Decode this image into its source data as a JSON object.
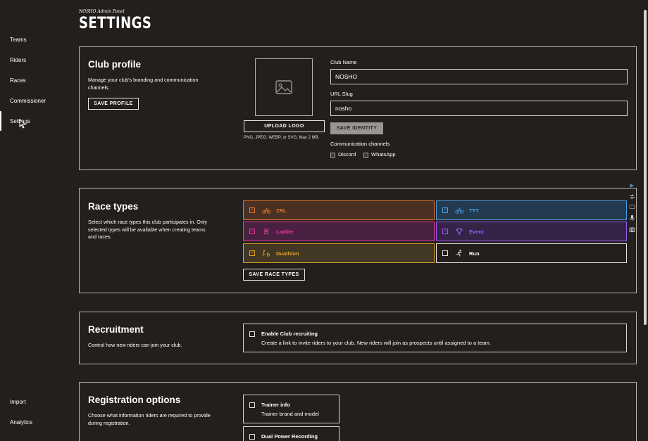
{
  "sidebar": {
    "items": [
      {
        "label": "Teams"
      },
      {
        "label": "Riders"
      },
      {
        "label": "Races"
      },
      {
        "label": "Commissioner"
      },
      {
        "label": "Settings",
        "active": true
      }
    ],
    "bottom_items": [
      {
        "label": "Import"
      },
      {
        "label": "Analytics"
      }
    ]
  },
  "header": {
    "subtitle": "NOSHO Admin Panel",
    "title": "SETTINGS"
  },
  "club_profile": {
    "title": "Club profile",
    "description": "Manage your club's branding and communication channels.",
    "save_label": "SAVE PROFILE",
    "upload_logo_label": "UPLOAD LOGO",
    "logo_hint": "PNG, JPEG, WEBP, or SVG. Max 2 MB.",
    "club_name_label": "Club Name",
    "club_name_value": "NOSHO",
    "url_slug_label": "URL Slug",
    "url_slug_value": "nosho",
    "save_identity_label": "SAVE IDENTITY",
    "channels_label": "Communication channels",
    "channels": [
      {
        "label": "Discord",
        "checked": false
      },
      {
        "label": "WhatsApp",
        "checked": false
      }
    ]
  },
  "race_types": {
    "title": "Race types",
    "description": "Select which race types this club participates in. Only selected types will be available when creating teams and races.",
    "save_label": "SAVE RACE TYPES",
    "types": [
      {
        "label": "ZRL",
        "checked": true,
        "color": "#e8762e",
        "bg": "#4a3124",
        "icon": "cyclist-icon"
      },
      {
        "label": "TTT",
        "checked": true,
        "color": "#4aa0e6",
        "bg": "#243a4e",
        "icon": "bike-icon"
      },
      {
        "label": "Ladder",
        "checked": true,
        "color": "#e63aa6",
        "bg": "#4a2040",
        "icon": "ladder-icon"
      },
      {
        "label": "Event",
        "checked": true,
        "color": "#9a5cf0",
        "bg": "#352448",
        "icon": "trophy-icon"
      },
      {
        "label": "Duathlon",
        "checked": true,
        "color": "#e0a424",
        "bg": "#423624",
        "icon": "duathlon-icon"
      },
      {
        "label": "Run",
        "checked": false,
        "color": "#ffffff",
        "bg": "#221f1d",
        "icon": "runner-icon"
      }
    ]
  },
  "recruitment": {
    "title": "Recruitment",
    "description": "Control how new riders can join your club.",
    "option_title": "Enable Club recruiting",
    "option_desc": "Create a link to invite riders to your club. New riders will join as prospects until assigned to a team."
  },
  "registration": {
    "title": "Registration options",
    "description": "Choose what information riders are required to provide during registration.",
    "options": [
      {
        "title": "Trainer info",
        "desc": "Trainer brand and model"
      },
      {
        "title": "Dual Power Recording",
        "desc": ""
      }
    ]
  }
}
